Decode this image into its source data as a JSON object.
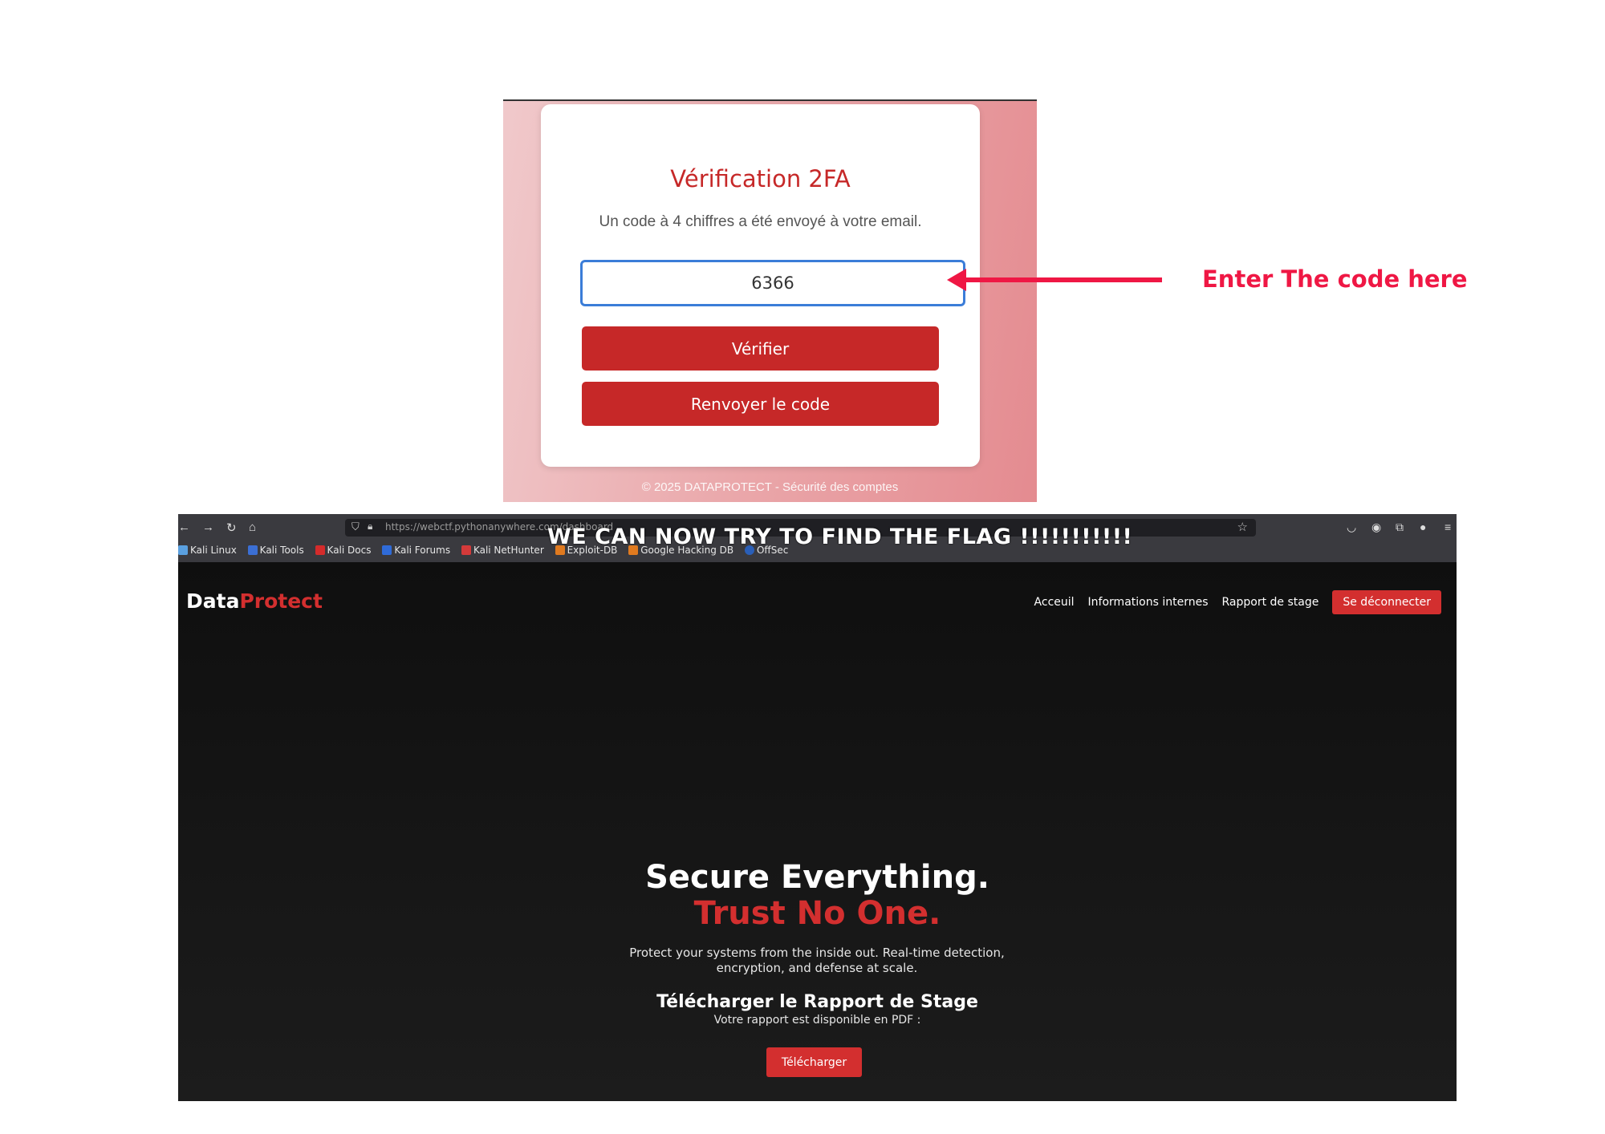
{
  "twofa": {
    "title": "Vérification 2FA",
    "subtitle": "Un code à 4 chiffres a été envoyé à votre email.",
    "code_value": "6366",
    "verify_label": "Vérifier",
    "resend_label": "Renvoyer le code",
    "footer": "© 2025 DATAPROTECT - Sécurité des comptes"
  },
  "annotation": {
    "text": "Enter The code here",
    "color": "#ef1744"
  },
  "browser": {
    "url": "https://webctf.pythonanywhere.com/dashboard",
    "overlay_text": "WE  CAN NOW TRY TO FIND  THE FLAG !!!!!!!!!!!",
    "bookmarks": [
      "Kali Linux",
      "Kali Tools",
      "Kali Docs",
      "Kali Forums",
      "Kali NetHunter",
      "Exploit-DB",
      "Google Hacking DB",
      "OffSec"
    ],
    "icons": [
      "back-icon",
      "forward-icon",
      "reload-icon",
      "home-icon",
      "shield-icon",
      "lock-icon",
      "star-icon",
      "pocket-icon",
      "account-icon",
      "extensions-icon",
      "profile-icon",
      "menu-icon"
    ]
  },
  "site": {
    "brand_part1": "Data",
    "brand_part2": "Protect",
    "nav": [
      "Acceuil",
      "Informations internes",
      "Rapport de stage"
    ],
    "logout_label": "Se déconnecter",
    "hero_line1": "Secure Everything.",
    "hero_line2": "Trust No One.",
    "hero_desc": "Protect your systems from the inside out. Real-time detection, encryption, and defense at scale.",
    "report_title": "Télécharger le Rapport de Stage",
    "report_sub": "Votre rapport est disponible en PDF :",
    "download_label": "Télécharger",
    "accent_color": "#d32f2f"
  }
}
